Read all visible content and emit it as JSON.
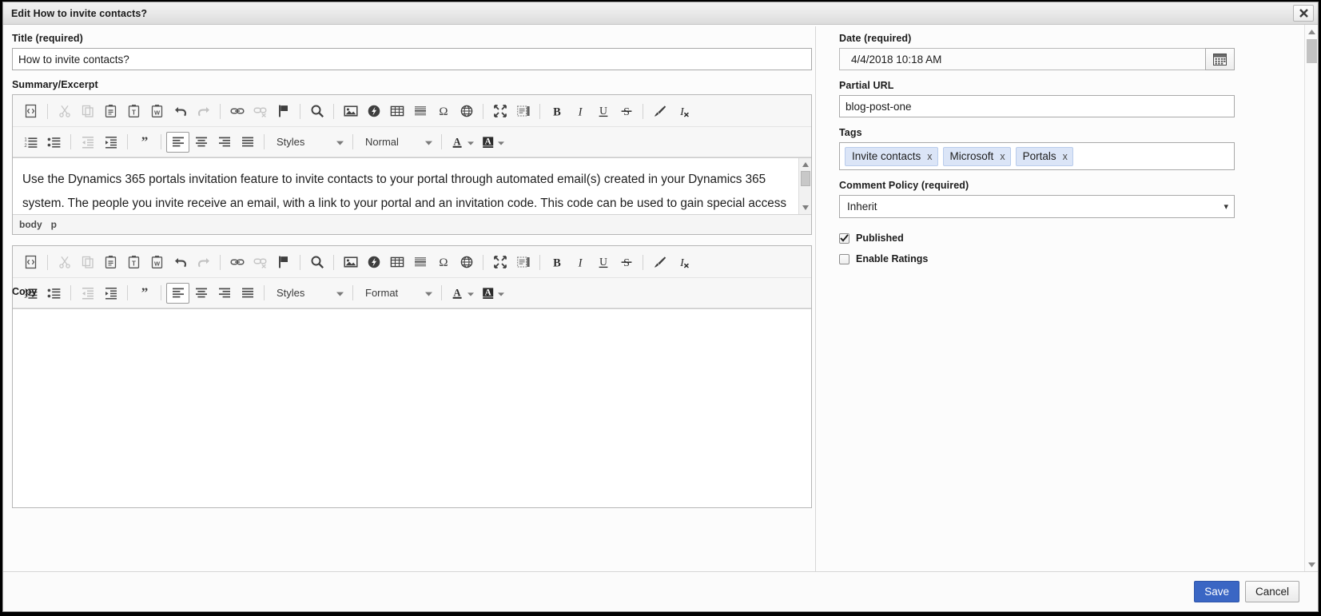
{
  "window": {
    "title": "Edit How to invite contacts?",
    "close_icon": "close-icon"
  },
  "left": {
    "title_label": "Title (required)",
    "title_value": "How to invite contacts?",
    "summary_label": "Summary/Excerpt",
    "copy_label": "Copy",
    "summary_text": "Use the Dynamics 365 portals invitation feature to invite contacts to your portal through automated email(s) created in your Dynamics 365 system. The people you invite receive an email, with a link to your portal and an invitation code. This code can be used to gain special access configured by you. With this feature you have the ability to:",
    "copy_text": "",
    "elements_path": [
      "body",
      "p"
    ]
  },
  "editor_toolbar": {
    "row1": [
      {
        "name": "source-icon",
        "label": "Source",
        "state": "normal"
      },
      {
        "name": "separator",
        "label": "",
        "state": "sep"
      },
      {
        "name": "cut-icon",
        "label": "Cut",
        "state": "disabled"
      },
      {
        "name": "copy-icon",
        "label": "Copy",
        "state": "disabled"
      },
      {
        "name": "paste-icon",
        "label": "Paste",
        "state": "normal"
      },
      {
        "name": "paste-text-icon",
        "label": "Paste as plain text",
        "state": "normal"
      },
      {
        "name": "paste-word-icon",
        "label": "Paste from Word",
        "state": "normal"
      },
      {
        "name": "undo-icon",
        "label": "Undo",
        "state": "normal"
      },
      {
        "name": "redo-icon",
        "label": "Redo",
        "state": "disabled"
      },
      {
        "name": "separator",
        "label": "",
        "state": "sep"
      },
      {
        "name": "link-icon",
        "label": "Link",
        "state": "normal"
      },
      {
        "name": "unlink-icon",
        "label": "Unlink",
        "state": "disabled"
      },
      {
        "name": "anchor-flag-icon",
        "label": "Anchor",
        "state": "normal"
      },
      {
        "name": "separator",
        "label": "",
        "state": "sep"
      },
      {
        "name": "search-icon",
        "label": "Find",
        "state": "normal"
      },
      {
        "name": "separator",
        "label": "",
        "state": "sep"
      },
      {
        "name": "image-icon",
        "label": "Image",
        "state": "normal"
      },
      {
        "name": "flash-icon",
        "label": "Flash",
        "state": "normal"
      },
      {
        "name": "table-icon",
        "label": "Table",
        "state": "normal"
      },
      {
        "name": "horizontal-rule-icon",
        "label": "Horizontal Line",
        "state": "normal"
      },
      {
        "name": "special-char-icon",
        "label": "Special Character",
        "state": "normal"
      },
      {
        "name": "iframe-globe-icon",
        "label": "IFrame",
        "state": "normal"
      },
      {
        "name": "separator",
        "label": "",
        "state": "sep"
      },
      {
        "name": "maximize-icon",
        "label": "Maximize",
        "state": "normal"
      },
      {
        "name": "show-blocks-icon",
        "label": "Show Blocks",
        "state": "normal"
      },
      {
        "name": "separator",
        "label": "",
        "state": "sep"
      },
      {
        "name": "bold-icon",
        "label": "Bold",
        "state": "normal"
      },
      {
        "name": "italic-icon",
        "label": "Italic",
        "state": "normal"
      },
      {
        "name": "underline-icon",
        "label": "Underline",
        "state": "normal"
      },
      {
        "name": "strikethrough-icon",
        "label": "Strikethrough",
        "state": "normal"
      },
      {
        "name": "separator",
        "label": "",
        "state": "sep"
      },
      {
        "name": "copy-format-brush-icon",
        "label": "Copy Formatting",
        "state": "normal"
      },
      {
        "name": "remove-format-icon",
        "label": "Remove Format",
        "state": "normal"
      }
    ],
    "row2": [
      {
        "name": "numbered-list-icon",
        "label": "Insert/Remove Numbered List",
        "state": "normal"
      },
      {
        "name": "bulleted-list-icon",
        "label": "Insert/Remove Bulleted List",
        "state": "normal"
      },
      {
        "name": "separator",
        "label": "",
        "state": "sep"
      },
      {
        "name": "outdent-icon",
        "label": "Decrease Indent",
        "state": "disabled"
      },
      {
        "name": "indent-icon",
        "label": "Increase Indent",
        "state": "normal"
      },
      {
        "name": "separator",
        "label": "",
        "state": "sep"
      },
      {
        "name": "blockquote-icon",
        "label": "Block Quote",
        "state": "normal"
      },
      {
        "name": "separator",
        "label": "",
        "state": "sep"
      },
      {
        "name": "align-left-icon",
        "label": "Align Left",
        "state": "active"
      },
      {
        "name": "align-center-icon",
        "label": "Center",
        "state": "normal"
      },
      {
        "name": "align-right-icon",
        "label": "Align Right",
        "state": "normal"
      },
      {
        "name": "justify-icon",
        "label": "Justify",
        "state": "normal"
      },
      {
        "name": "separator",
        "label": "",
        "state": "sep"
      }
    ],
    "styles_label": "Styles",
    "format_label_summary": "Normal",
    "format_label_copy": "Format",
    "text_color_icon": "text-color-icon",
    "bg_color_icon": "background-color-icon"
  },
  "right": {
    "date_label": "Date (required)",
    "date_value": "4/4/2018 10:18 AM",
    "calendar_icon": "calendar-icon",
    "url_label": "Partial URL",
    "url_value": "blog-post-one",
    "tags_label": "Tags",
    "tags": [
      "Invite contacts",
      "Microsoft",
      "Portals"
    ],
    "tag_remove_label": "x",
    "comment_policy_label": "Comment Policy (required)",
    "comment_policy_value": "Inherit",
    "checkboxes": [
      {
        "label": "Published",
        "checked": true
      },
      {
        "label": "Enable Ratings",
        "checked": false
      }
    ]
  },
  "footer": {
    "save_label": "Save",
    "cancel_label": "Cancel"
  },
  "colors": {
    "primary_button": "#3a66c4",
    "tag_background": "#dbe5f7",
    "titlebar": "#e9e9e9"
  }
}
